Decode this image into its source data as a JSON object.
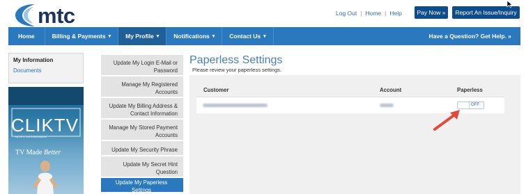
{
  "brand": {
    "logo_text": "mtc"
  },
  "header": {
    "links": [
      "Log Out",
      "Home",
      "Help"
    ],
    "pay_button": "Pay Now »",
    "report_button": "Report An Issue/Inquiry"
  },
  "nav": {
    "items": [
      {
        "label": "Home",
        "caret": ""
      },
      {
        "label": "Billing & Payments",
        "caret": "▾"
      },
      {
        "label": "My Profile",
        "caret": "▾"
      },
      {
        "label": "Notifications",
        "caret": "▾"
      },
      {
        "label": "Contact Us",
        "caret": "▾"
      }
    ],
    "help": "Have a Question? Get Help. »"
  },
  "sidebar": {
    "title": "My Information",
    "link": "Documents"
  },
  "banner": {
    "brand": "CLIKTV",
    "sub": "by MTC Communications",
    "tagline_a": "TV Made ",
    "tagline_b": "Better"
  },
  "submenu": [
    "Update My Login E-Mail or Password",
    "Manage My Registered Accounts",
    "Update My Billing Address & Contact Information",
    "Manage My Stored Payment Accounts",
    "Update My Security Phrase",
    "Update My Secret Hint Question",
    "Update My Paperless Settings"
  ],
  "main": {
    "title": "Paperless Settings",
    "subtitle": "Please review your paperless settings.",
    "columns": [
      "Customer",
      "Account",
      "Paperless"
    ],
    "toggle_label": "OFF"
  },
  "colors": {
    "nav_blue": "#2a78bd",
    "button_blue": "#0e4d8c",
    "title_blue": "#4a7fb5",
    "arrow_red": "#e04b3a"
  }
}
